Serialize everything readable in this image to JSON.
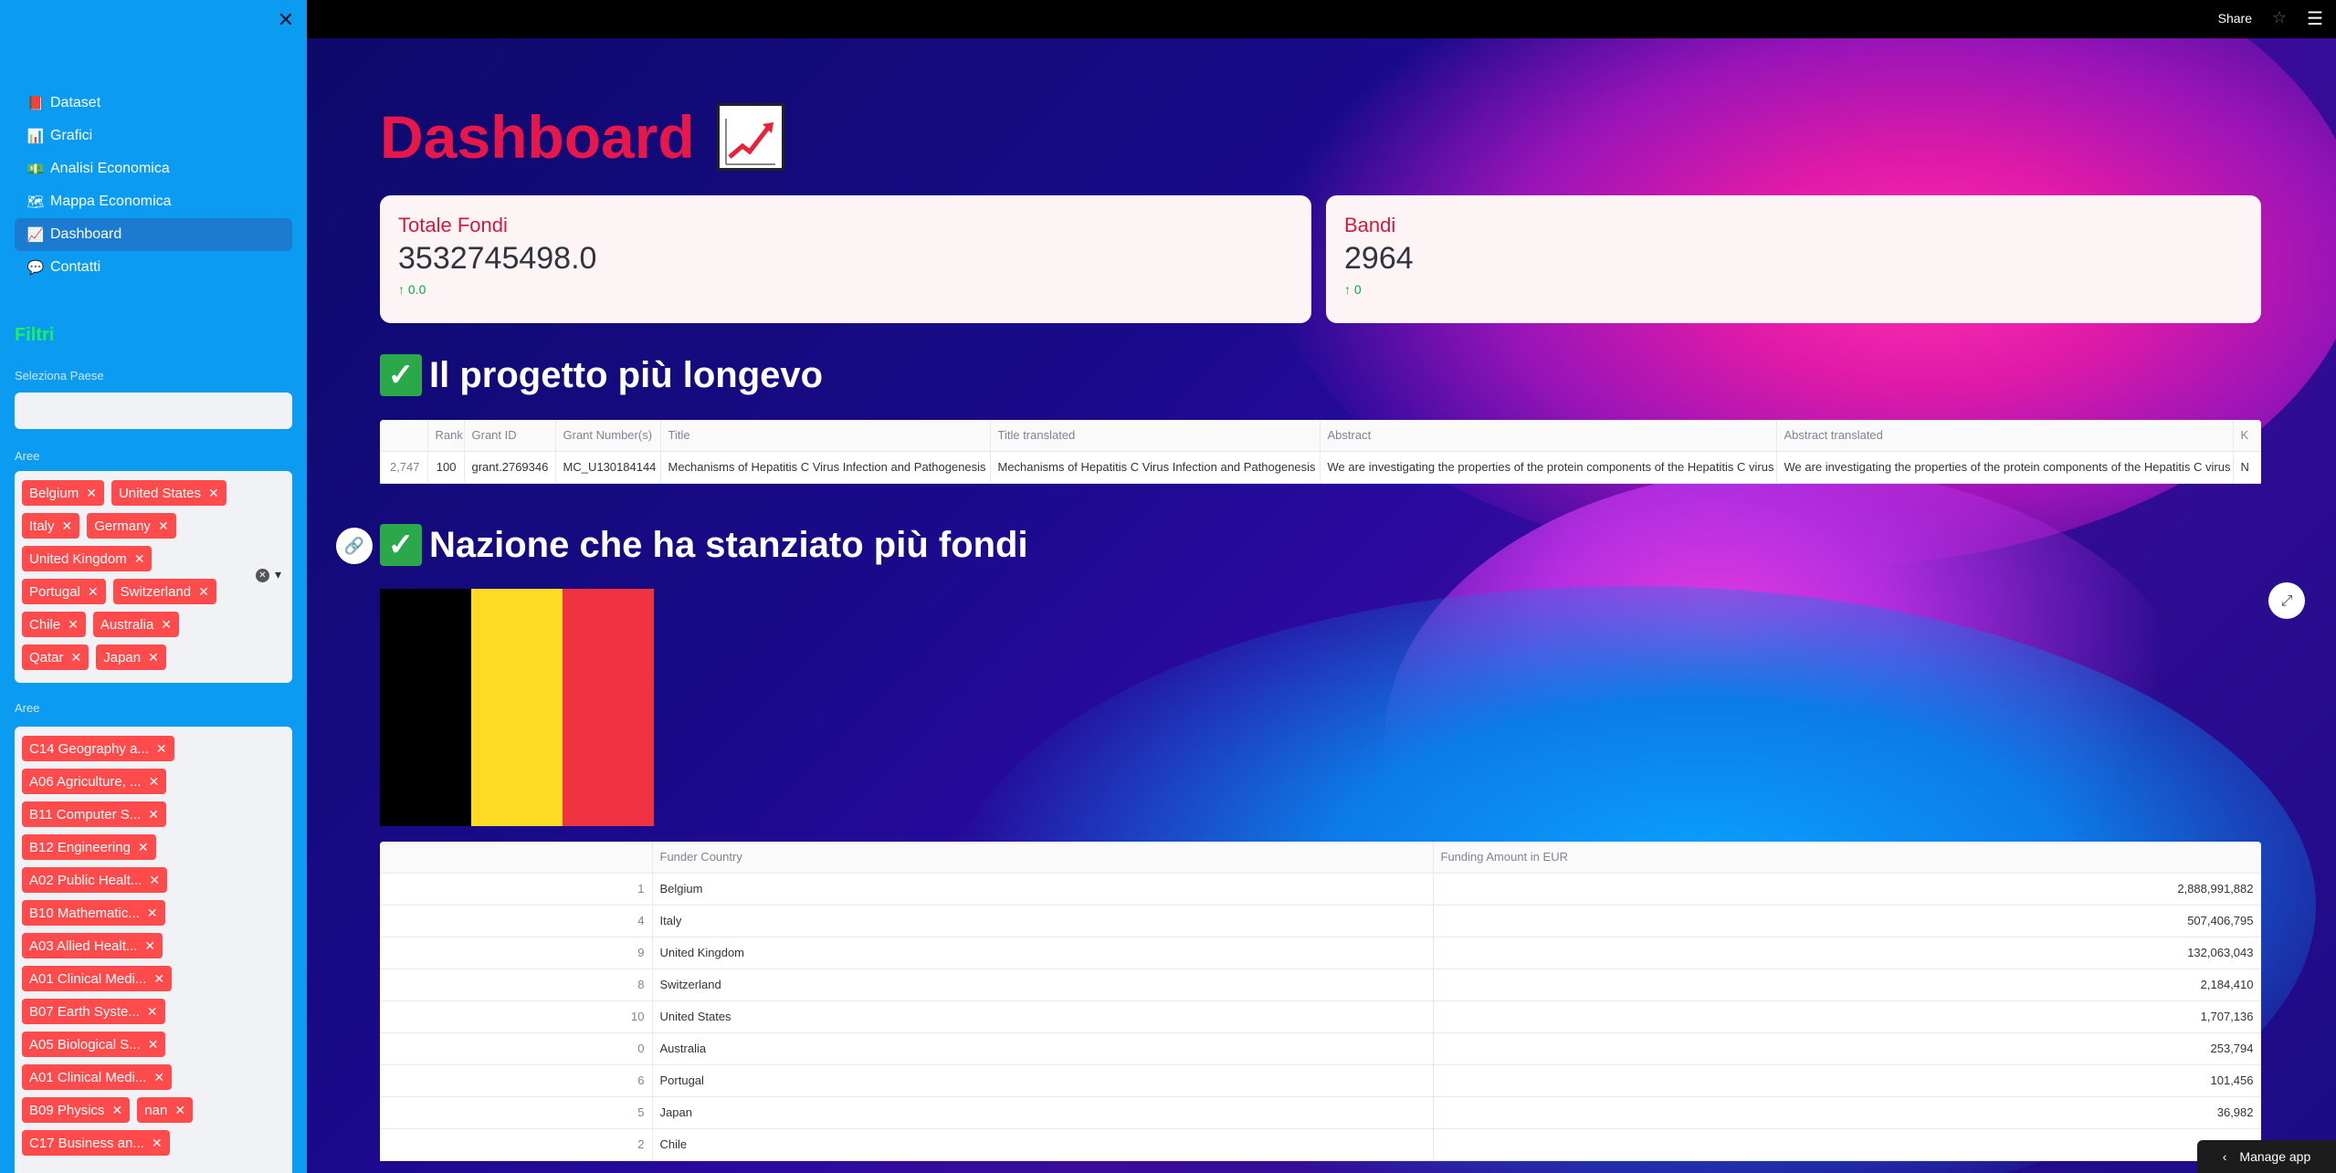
{
  "sidebar": {
    "nav": [
      {
        "label": "Dataset",
        "icon": "📕",
        "icon_name": "red-book-icon"
      },
      {
        "label": "Grafici",
        "icon": "📊",
        "icon_name": "bar-chart-icon"
      },
      {
        "label": "Analisi Economica",
        "icon": "💵",
        "icon_name": "banknote-icon"
      },
      {
        "label": "Mappa Economica",
        "icon": "🗺",
        "icon_name": "world-map-icon"
      },
      {
        "label": "Dashboard",
        "icon": "📈",
        "icon_name": "chart-increasing-icon",
        "active": true
      },
      {
        "label": "Contatti",
        "icon": "💬",
        "icon_name": "speech-balloon-icon"
      }
    ],
    "filters_title": "Filtri",
    "country_label": "Seleziona Paese",
    "countries_label": "Aree",
    "countries": [
      "Belgium",
      "United States",
      "Italy",
      "Germany",
      "United Kingdom",
      "Portugal",
      "Switzerland",
      "Chile",
      "Australia",
      "Qatar",
      "Japan"
    ],
    "areas_label": "Aree",
    "areas": [
      "C14 Geography a...",
      "A06 Agriculture, ...",
      "B11 Computer S...",
      "B12 Engineering",
      "A02 Public Healt...",
      "B10 Mathematic...",
      "A03 Allied Healt...",
      "A01 Clinical Medi...",
      "B07 Earth Syste...",
      "A05 Biological S...",
      "A01 Clinical Medi...",
      "B09 Physics",
      "nan",
      "C17 Business an..."
    ]
  },
  "topbar": {
    "share_label": "Share"
  },
  "main": {
    "title": "Dashboard",
    "metrics": [
      {
        "label": "Totale Fondi",
        "value": "3532745498.0",
        "delta": "0.0"
      },
      {
        "label": "Bandi",
        "value": "2964",
        "delta": "0"
      }
    ],
    "section1_title": "Il progetto più longevo",
    "project_table": {
      "columns": [
        "",
        "Rank",
        "Grant ID",
        "Grant Number(s)",
        "Title",
        "Title translated",
        "Abstract",
        "Abstract translated",
        "K"
      ],
      "rows": [
        [
          "2,747",
          "100",
          "grant.2769346",
          "MC_U130184144",
          "Mechanisms of Hepatitis C Virus Infection and Pathogenesis",
          "Mechanisms of Hepatitis C Virus Infection and Pathogenesis",
          "We are investigating the properties of the protein components of the Hepatitis C virus",
          "We are investigating the properties of the protein components of the Hepatitis C virus",
          "N"
        ]
      ]
    },
    "section2_title": "Nazione che ha stanziato più fondi",
    "flag_colors": [
      "#000000",
      "#fdda24",
      "#ef3340"
    ],
    "country_table": {
      "columns": [
        "",
        "Funder Country",
        "Funding Amount in EUR"
      ],
      "rows": [
        [
          "1",
          "Belgium",
          "2,888,991,882"
        ],
        [
          "4",
          "Italy",
          "507,406,795"
        ],
        [
          "9",
          "United Kingdom",
          "132,063,043"
        ],
        [
          "8",
          "Switzerland",
          "2,184,410"
        ],
        [
          "10",
          "United States",
          "1,707,136"
        ],
        [
          "0",
          "Australia",
          "253,794"
        ],
        [
          "6",
          "Portugal",
          "101,456"
        ],
        [
          "5",
          "Japan",
          "36,982"
        ],
        [
          "2",
          "Chile",
          ""
        ]
      ]
    }
  },
  "manage_app_label": "Manage app"
}
